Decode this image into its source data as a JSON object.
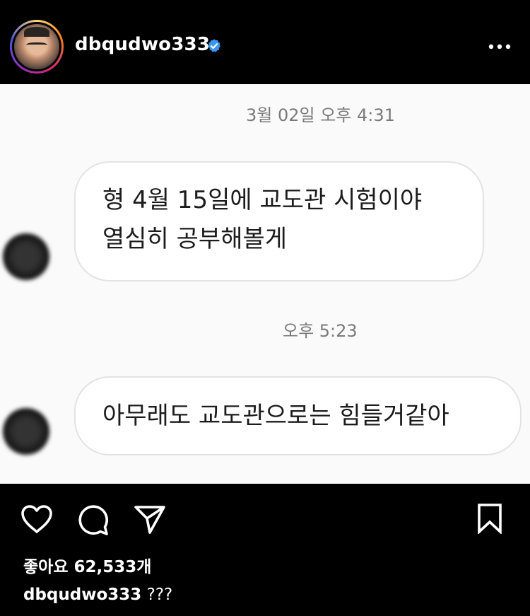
{
  "header": {
    "username": "dbqudwo333",
    "verified_icon": "verified-badge-icon",
    "more_icon": "more-horizontal-icon"
  },
  "post_image": {
    "timestamp_1": "3월 02일 오후 4:31",
    "message_1_line_1": "형 4월 15일에 교도관 시험이야",
    "message_1_line_2": "열심히 공부해볼게",
    "timestamp_2": "오후 5:23",
    "message_2": "아무래도 교도관으로는 힘들거같아"
  },
  "actions": {
    "like_icon": "heart-icon",
    "comment_icon": "comment-icon",
    "share_icon": "paper-plane-icon",
    "save_icon": "bookmark-icon"
  },
  "likes_text": "좋아요 62,533개",
  "caption": {
    "username": "dbqudwo333",
    "text": "???"
  },
  "colors": {
    "verified_blue": "#3897f0",
    "background": "#000000"
  }
}
